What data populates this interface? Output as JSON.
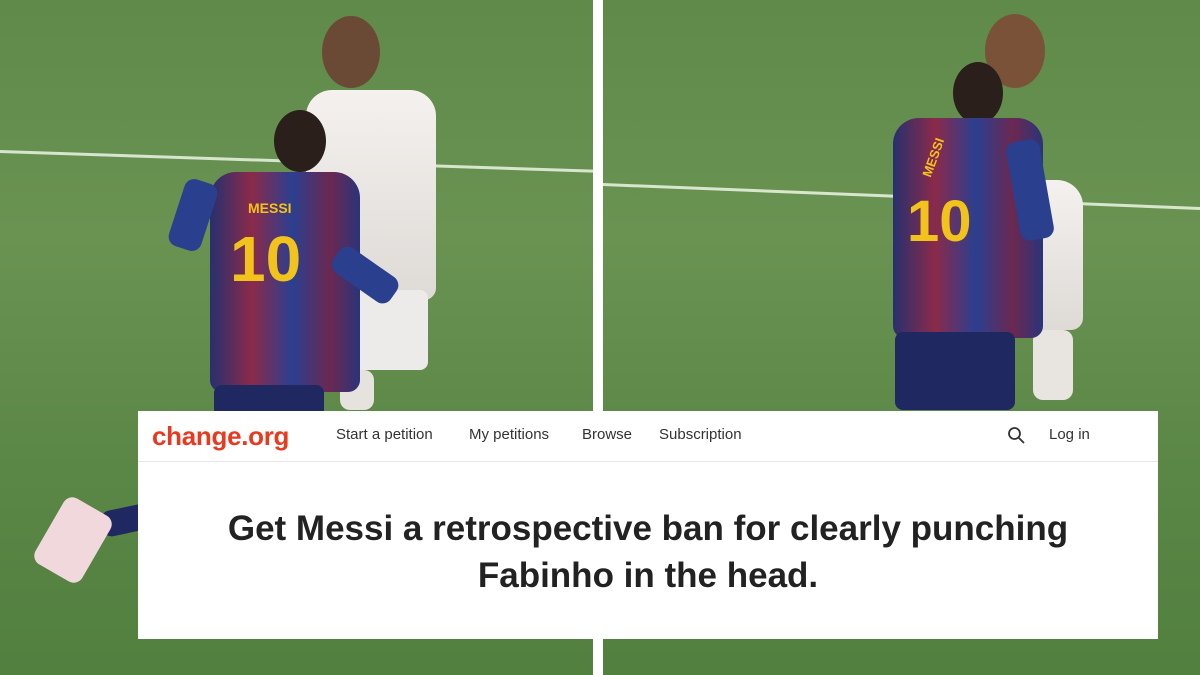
{
  "site": {
    "logo": "change.org",
    "brand_color": "#e83a20"
  },
  "nav": {
    "items": [
      {
        "label": "Start a petition"
      },
      {
        "label": "My petitions"
      },
      {
        "label": "Browse"
      },
      {
        "label": "Subscription"
      }
    ],
    "search_icon": "search-icon",
    "login_label": "Log in"
  },
  "petition": {
    "title_line1": "Get Messi a retrospective ban for clearly punching",
    "title_line2": "Fabinho in the head."
  },
  "frames": {
    "left": {
      "shirt_number": "10",
      "shirt_name": "MESSI"
    },
    "right": {
      "shirt_number": "10",
      "shirt_name": "MESSI"
    }
  }
}
